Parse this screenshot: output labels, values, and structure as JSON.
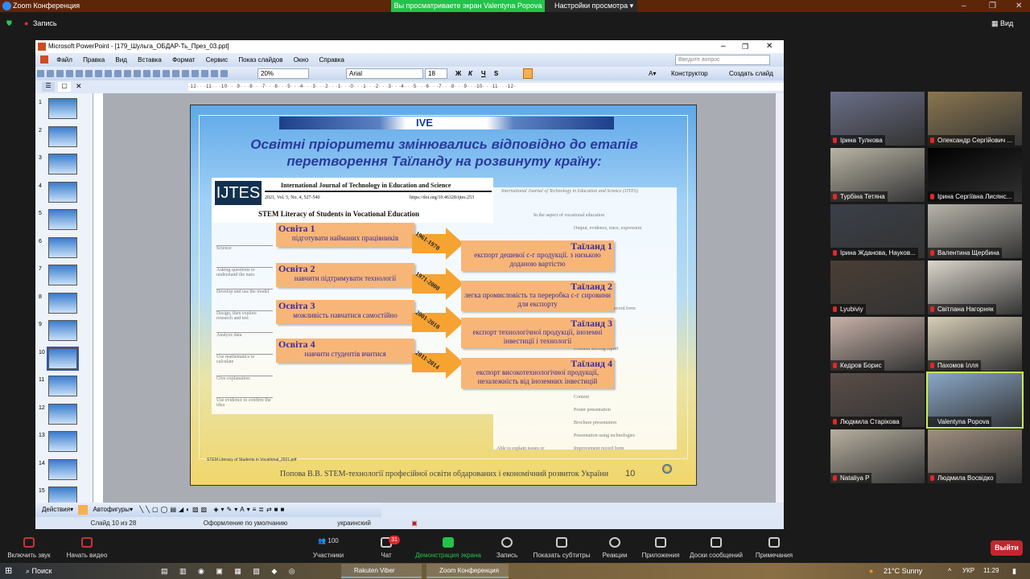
{
  "zoom": {
    "title": "Zoom Конференция",
    "banner": "Вы просматриваете экран Valentyna Popova",
    "view_settings": "Настройки просмотра",
    "record": "Запись",
    "view": "Вид"
  },
  "ppt": {
    "title": "Microsoft PowerPoint - [179_Шульга_ОБДАР-Ть_През_03.ppt]",
    "menu": [
      "Файл",
      "Правка",
      "Вид",
      "Вставка",
      "Формат",
      "Сервис",
      "Показ слайдов",
      "Окно",
      "Справка"
    ],
    "ask_placeholder": "Введите вопрос",
    "zoom_value": "20%",
    "font": "Arial",
    "font_size": "18",
    "designer": "Конструктор",
    "new_slide": "Создать слайд",
    "ruler": "·12· · ·11· · ·10· · ·9· · ·8· · ·7· · ·6· · ·5· · ·4· · ·3· · ·2· · ·1· · ·0· · ·1· · ·2· · ·3· · ·4· · ·5· · ·6· · ·7· · ·8· · ·9· · ·10· · ·11· · ·12·",
    "thumbnails": [
      "1",
      "2",
      "3",
      "4",
      "5",
      "6",
      "7",
      "8",
      "9",
      "10",
      "11",
      "12",
      "13",
      "14",
      "15"
    ],
    "selected_slide": "10",
    "drawbar": {
      "actions": "Действия",
      "autoshapes": "Автофигуры"
    },
    "status": {
      "slide": "Слайд 10 из 28",
      "design": "Оформление по умолчанию",
      "lang": "украинский"
    }
  },
  "slide": {
    "logo": "IVE",
    "title_line1": "Освітні пріоритети змінювались відповідно до етапів",
    "title_line2": "перетворення Таїланду на розвинуту країну:",
    "journal": {
      "abbr": "IJTES",
      "name": "International Journal of Technology in Education and Science",
      "vol": "2021, Vol. 5, No. 4, 527-540",
      "doi": "https://doi.org/10.46328/ijtes.253",
      "article": "STEM Literacy of Students in Vocational Education",
      "right_header": "International Journal of Technology in Education and Science (IJTES)",
      "right_sub": "In the aspect of vocational education"
    },
    "left_table": [
      "Science",
      "Asking questions to understand the natu",
      "Develop and use the model",
      "Design, then explore research and test",
      "Analyze data",
      "Use mathematics to calculate",
      "Give explanation",
      "Use evidence to confirm the idea"
    ],
    "right_table": [
      "Output, evidence, trace, expression",
      "Experiments, result record form",
      "Problem solving report",
      "Content",
      "Poster presentation",
      "Brochure presentation",
      "Presentation using technologies",
      "Improvement record form",
      "Able to explain issues or"
    ],
    "education": [
      {
        "h": "Освіта 1",
        "t": "підготувати найманих працівників"
      },
      {
        "h": "Освіта 2",
        "t": "навчити підтримувати технології"
      },
      {
        "h": "Освіта 3",
        "t": "можливість навчатися самостійно"
      },
      {
        "h": "Освіта 4",
        "t": "навчити студентів вчитися"
      }
    ],
    "periods": [
      "1961-1970",
      "1971-2000",
      "2001-2010",
      "2011-2014"
    ],
    "thailand": [
      {
        "h": "Таїланд 1",
        "t": "експорт дешевої с-г продукції. з низькою доданою вартістю"
      },
      {
        "h": "Таїланд 2",
        "t": "легка промисловість та переробка с-г сировини для експорту"
      },
      {
        "h": "Таїланд 3",
        "t": "експорт технологічної продукції, іноземні інвестиції і технології"
      },
      {
        "h": "Таїланд 4",
        "t": "експорт високотехнологічної продукції, незалежність від іноземних інвестицій"
      }
    ],
    "source": "STEM Literacy of Students in Vocational_2021.pdf",
    "footer": "Попова В.В. STEM-технології професійної освіти обдарованих і економічний розвиток України",
    "page": "10"
  },
  "participants": [
    "Ірина Тулнова",
    "Олександр Сергійович ...",
    "Турбіна Тетяна",
    "Ірина Сергіївна Лисянс...",
    "Ірина Жданова, Науков...",
    "Валентина Щербина",
    "Lyubiviy",
    "Світлана Нагорняк",
    "Кедров Борис",
    "Пахомов Ілля",
    "Людмила Старікова",
    "Valentyna Popova",
    "Nataliya P",
    "Людмила Восвідко"
  ],
  "active_speaker": "Valentyna Popova",
  "toolbar": {
    "audio": "Включить звук",
    "video": "Начать видео",
    "participants": "Участники",
    "participants_count": "100",
    "chat": "Чат",
    "chat_badge": "31",
    "share": "Демонстрация экрана",
    "record": "Запись",
    "captions": "Показать субтитры",
    "reactions": "Реакции",
    "apps": "Приложения",
    "whiteboards": "Доски сообщений",
    "notes": "Примечания",
    "leave": "Выйти"
  },
  "taskbar": {
    "search": "Поиск",
    "viber": "Rakuten Viber",
    "zoom": "Zoom Конференция",
    "weather": "21°C  Sunny",
    "lang": "УКР",
    "time": "11:29"
  },
  "colors": {
    "zoom_title": "#5e2608",
    "banner": "#23c24b",
    "leave": "#c4262e",
    "orange_box": "#f7b678",
    "arrow": "#f6a332",
    "title_text": "#2a3a9e"
  }
}
